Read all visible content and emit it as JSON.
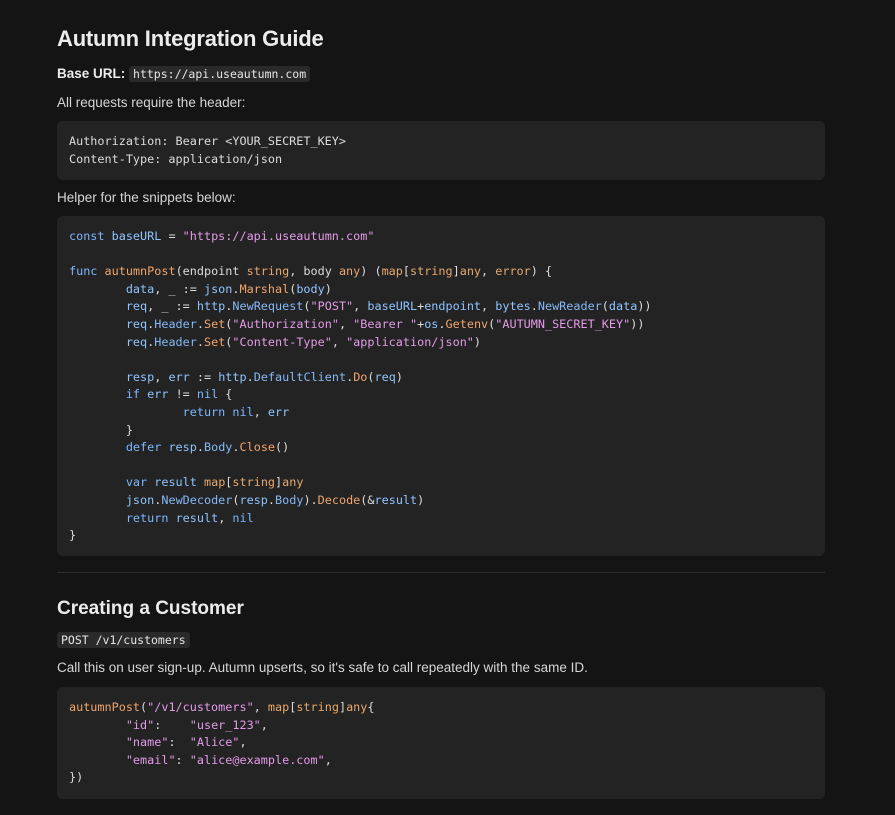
{
  "guide": {
    "title": "Autumn Integration Guide",
    "base_url_label": "Base URL:",
    "base_url_value": "https://api.useautumn.com",
    "header_intro": "All requests require the header:",
    "header_block": [
      "Authorization: Bearer <YOUR_SECRET_KEY>",
      "Content-Type: application/json"
    ],
    "helper_intro": "Helper for the snippets below:"
  },
  "helper_code": {
    "l1_kw": "const",
    "l1_var": "baseURL",
    "l1_eq": " = ",
    "l1_str": "\"https://api.useautumn.com\"",
    "l3_kw": "func",
    "l3_fn": "autumnPost",
    "l3_rest1": "(endpoint ",
    "l3_ty1": "string",
    "l3_rest2": ", body ",
    "l3_ty2": "any",
    "l3_rest3": ") (",
    "l3_ty3": "map",
    "l3_rest4": "[",
    "l3_ty4": "string",
    "l3_rest5": "]",
    "l3_ty5": "any",
    "l3_rest6": ", ",
    "l3_ty6": "error",
    "l3_rest7": ") {",
    "l4_v1": "data",
    "l4_a": ", _ := ",
    "l4_v2": "json",
    "l4_dot": ".",
    "l4_fn": "Marshal",
    "l4_b": "(",
    "l4_v3": "body",
    "l4_c": ")",
    "l5_v1": "req",
    "l5_a": ", _ := ",
    "l5_v2": "http",
    "l5_fn": "NewRequest",
    "l5_str1": "\"POST\"",
    "l5_b": ", ",
    "l5_v3": "baseURL",
    "l5_plus": "+",
    "l5_v4": "endpoint",
    "l5_v5": "bytes",
    "l5_fn2": "NewReader",
    "l5_v6": "data",
    "l5_end": "))",
    "l6_v1": "req",
    "l6_m1": "Header",
    "l6_fn": "Set",
    "l6_str1": "\"Authorization\"",
    "l6_str2": "\"Bearer \"",
    "l6_v2": "os",
    "l6_fn2": "Getenv",
    "l6_str3": "\"AUTUMN_SECRET_KEY\"",
    "l7_v1": "req",
    "l7_m1": "Header",
    "l7_fn": "Set",
    "l7_str1": "\"Content-Type\"",
    "l7_str2": "\"application/json\"",
    "l9_v1": "resp",
    "l9_v2": "err",
    "l9_v3": "http",
    "l9_m1": "DefaultClient",
    "l9_fn": "Do",
    "l9_v4": "req",
    "l10_kw": "if",
    "l10_v": "err",
    "l10_op": " != ",
    "l10_kw2": "nil",
    "l11_kw": "return",
    "l11_kw2": "nil",
    "l11_v": "err",
    "l13_kw": "defer",
    "l13_v": "resp",
    "l13_m": "Body",
    "l13_fn": "Close",
    "l15_kw": "var",
    "l15_v": "result",
    "l15_ty1": "map",
    "l15_ty2": "string",
    "l15_ty3": "any",
    "l16_v1": "json",
    "l16_fn": "NewDecoder",
    "l16_v2": "resp",
    "l16_m": "Body",
    "l16_fn2": "Decode",
    "l16_v3": "result",
    "l17_kw": "return",
    "l17_v": "result",
    "l17_kw2": "nil"
  },
  "customer": {
    "title": "Creating a Customer",
    "endpoint": "POST /v1/customers",
    "description": "Call this on user sign-up. Autumn upserts, so it's safe to call repeatedly with the same ID.",
    "code": {
      "fn": "autumnPost",
      "path": "\"/v1/customers\"",
      "ty1": "map",
      "ty2": "string",
      "ty3": "any",
      "k_id": "\"id\"",
      "v_id": "\"user_123\"",
      "k_name": "\"name\"",
      "v_name": "\"Alice\"",
      "k_email": "\"email\"",
      "v_email": "\"alice@example.com\"",
      "close": "})"
    }
  }
}
